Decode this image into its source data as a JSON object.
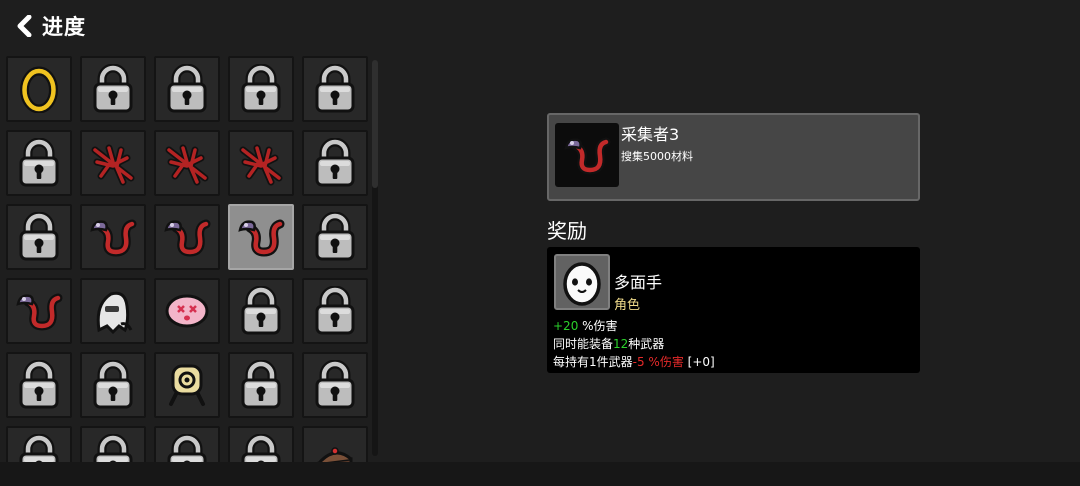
{
  "header": {
    "title": "进度"
  },
  "grid": {
    "cells": [
      "egg-icon",
      "lock-icon",
      "lock-icon",
      "lock-icon",
      "lock-icon",
      "lock-icon",
      "thorn-icon",
      "thorn-icon",
      "thorn-icon",
      "lock-icon",
      "lock-icon",
      "worm-icon",
      "worm-icon",
      "worm-icon",
      "lock-icon",
      "worm-icon",
      "ghost-icon",
      "blob-icon",
      "lock-icon",
      "lock-icon",
      "lock-icon",
      "lock-icon",
      "turret-icon",
      "lock-icon",
      "lock-icon",
      "lock-icon",
      "lock-icon",
      "lock-icon",
      "lock-icon",
      "cake-icon"
    ],
    "selected_index": 13
  },
  "detail": {
    "icon": "worm-icon",
    "name": "采集者3",
    "description": "搜集5000材料"
  },
  "reward": {
    "heading": "奖励",
    "icon": "egg-face-icon",
    "name": "多面手",
    "type": "角色",
    "stats": {
      "line1_value": "+20",
      "line1_text": " %伤害",
      "line2_pre": "同时能装备",
      "line2_value": "12",
      "line2_post": "种武器",
      "line3_pre": "每持有1件武器",
      "line3_value": "-5",
      "line3_mid": " %伤害",
      "line3_post": " [+0]"
    }
  },
  "colors": {
    "background": "#1e1e1e",
    "positive": "#2bd02b",
    "negative": "#e62a2a",
    "type_label": "#eed98a"
  }
}
